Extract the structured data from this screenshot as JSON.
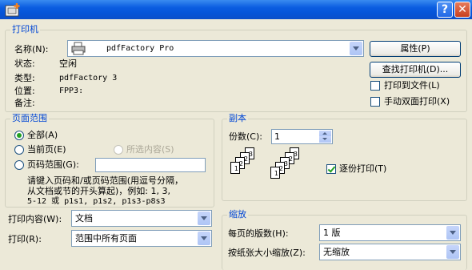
{
  "window": {
    "help_glyph": "?",
    "close_glyph": "✕"
  },
  "printer": {
    "legend": "打印机",
    "name_label": "名称(N):",
    "name_value": "pdfFactory Pro",
    "status_label": "状态:",
    "status_value": "空闲",
    "type_label": "类型:",
    "type_value": "pdfFactory 3",
    "location_label": "位置:",
    "location_value": "FPP3:",
    "comment_label": "备注:",
    "properties_button": "属性(P)",
    "find_printer_button": "查找打印机(D)...",
    "print_to_file": "打印到文件(L)",
    "manual_duplex": "手动双面打印(X)"
  },
  "page_range": {
    "legend": "页面范围",
    "all": "全部(A)",
    "current": "当前页(E)",
    "selection": "所选内容(S)",
    "pages": "页码范围(G):",
    "pages_value": "",
    "hint_line1": "请键入页码和/或页码范围(用逗号分隔，",
    "hint_line2": "从文档或节的开头算起)，例如: 1, 3,",
    "hint_line3": "5-12 或 p1s1, p1s2, p1s3-p8s3"
  },
  "copies": {
    "legend": "副本",
    "count_label": "份数(C):",
    "count_value": "1",
    "collate_label": "逐份打印(T)",
    "collate_checked": true,
    "page_numbers": [
      "1",
      "2",
      "3"
    ]
  },
  "print_what": {
    "label": "打印内容(W):",
    "value": "文档"
  },
  "print": {
    "label": "打印(R):",
    "value": "范围中所有页面"
  },
  "zoom": {
    "legend": "缩放",
    "pages_per_sheet_label": "每页的版数(H):",
    "pages_per_sheet_value": "1 版",
    "scale_label": "按纸张大小缩放(Z):",
    "scale_value": "无缩放"
  }
}
